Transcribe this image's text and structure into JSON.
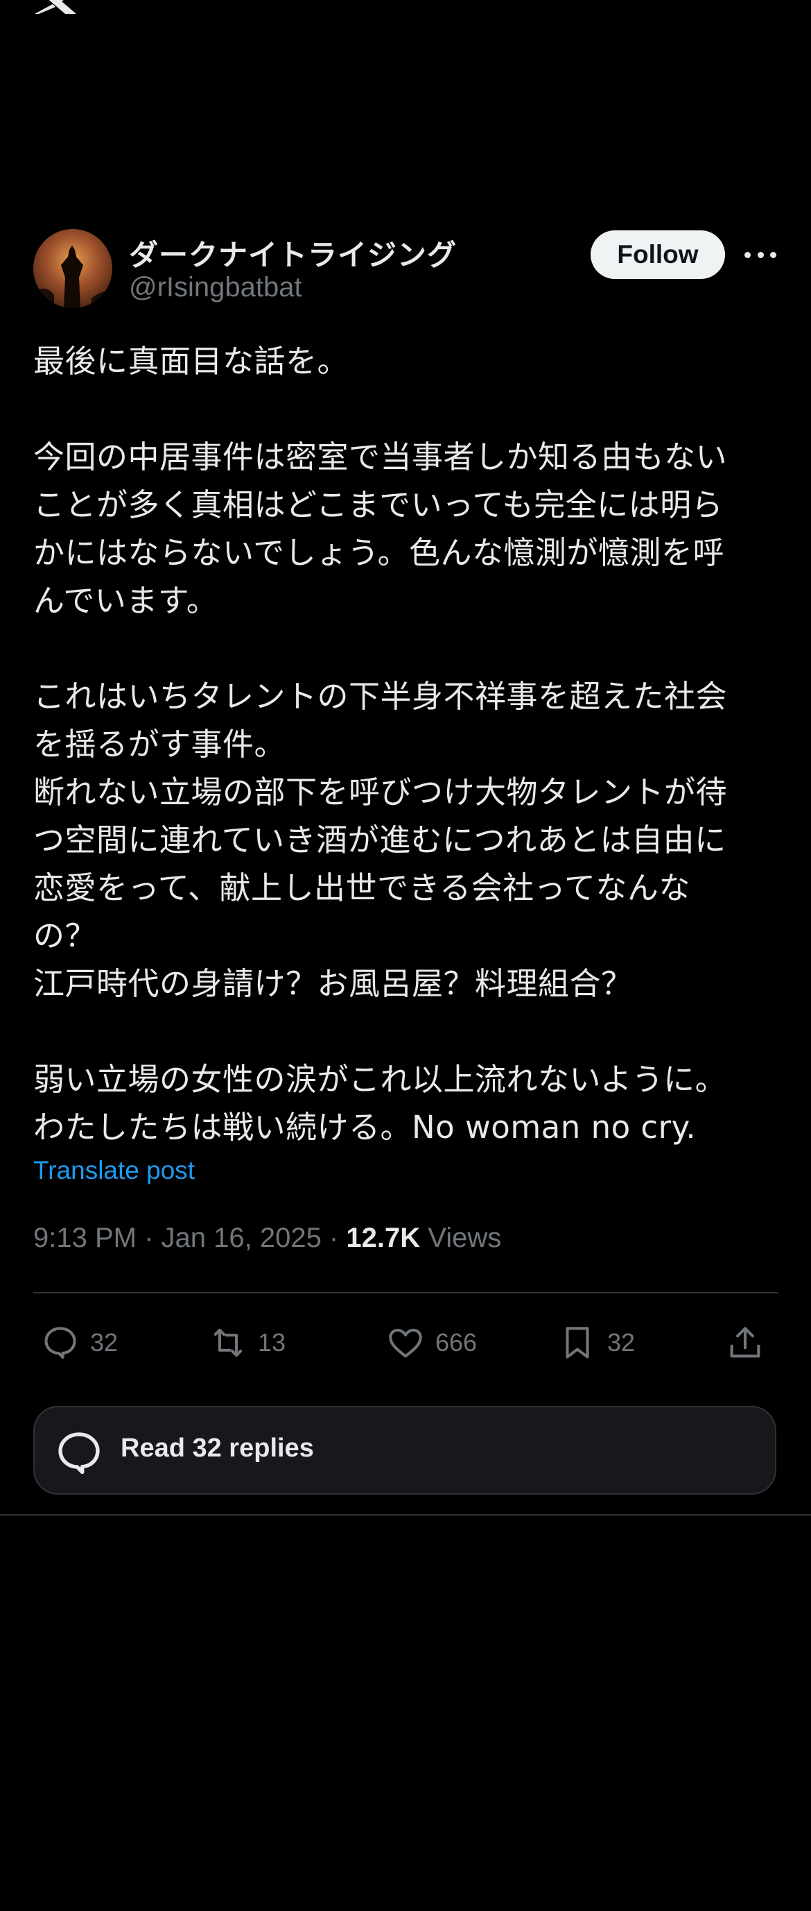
{
  "tweet": {
    "display_name": "ダークナイトライジング",
    "handle": "@rIsingbatbat",
    "follow_label": "Follow",
    "text": "最後に真面目な話を。\n\n今回の中居事件は密室で当事者しか知る由もない\nことが多く真相はどこまでいっても完全には明ら\nかにはならないでしょう。色んな憶測が憶測を呼\nんでいます。\n\nこれはいちタレントの下半身不祥事を超えた社会\nを揺るがす事件。\n断れない立場の部下を呼びつけ大物タレントが待\nつ空間に連れていき酒が進むにつれあとは自由に\n恋愛をって、献上し出世できる会社ってなんな\nの？\n江戸時代の身請け？お風呂屋？料理組合？\n\n弱い立場の女性の涙がこれ以上流れないように。\nわたしたちは戦い続ける。No woman no cry.",
    "translate_label": "Translate post",
    "timestamp": "9:13 PM · Jan 16, 2025 · ",
    "views_count": "12.7K",
    "views_label": " Views"
  },
  "actions": {
    "replies": "32",
    "reposts": "13",
    "likes": "666",
    "bookmarks": "32"
  },
  "read_replies_label": "Read 32 replies",
  "icons": {
    "logo": "x-logo-icon",
    "more": "more-icon",
    "reply": "reply-icon",
    "repost": "repost-icon",
    "like": "heart-icon",
    "bookmark": "bookmark-icon",
    "share": "share-icon"
  },
  "colors": {
    "background": "#000000",
    "text": "#e7e9ea",
    "muted": "#71767b",
    "link": "#1d9bf0",
    "follow_bg": "#eff3f4"
  }
}
